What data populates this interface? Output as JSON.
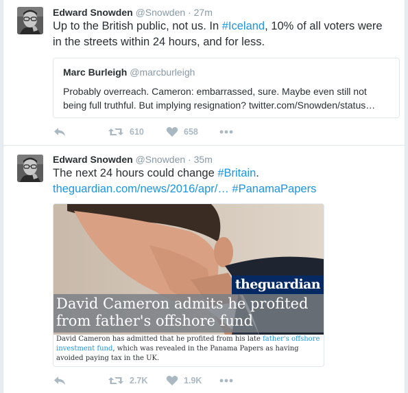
{
  "tweets": [
    {
      "name": "Edward Snowden",
      "handle": "@Snowden",
      "dot": "·",
      "time": "27m",
      "text_parts": [
        "Up to the British public, not us. In ",
        "#Iceland",
        ", 10% of all voters were in the streets within 24 hours, and for less."
      ],
      "quote": {
        "name": "Marc Burleigh",
        "handle": "@marcburleigh",
        "text": "Probably overreach. Cameron: embarrassed, sure. Maybe even still not being full truthful. But implying resignation? twitter.com/Snowden/status…"
      },
      "retweets": "610",
      "likes": "658"
    },
    {
      "name": "Edward Snowden",
      "handle": "@Snowden",
      "dot": "·",
      "time": "35m",
      "text_parts": [
        "The next 24 hours could change ",
        "#Britain",
        "."
      ],
      "link_line": [
        "theguardian.com/news/2016/apr/…",
        "#PanamaPapers"
      ],
      "card": {
        "brand": "theguardian",
        "headline": "David Cameron admits he profited from father's offshore fund",
        "desc_parts": [
          "David Cameron has admitted that he profited from his late ",
          "father's offshore investment fund",
          ", which was revealed in the Panama Papers as having avoided paying tax in the UK."
        ]
      },
      "retweets": "2.7K",
      "likes": "1.9K"
    }
  ],
  "icons": {
    "reply": "reply-icon",
    "retweet": "retweet-icon",
    "like": "heart-icon",
    "more": "more-icon"
  },
  "colors": {
    "link": "#1b95e0",
    "muted": "#8899a6",
    "action": "#aab8c2",
    "guardian": "#052962"
  }
}
